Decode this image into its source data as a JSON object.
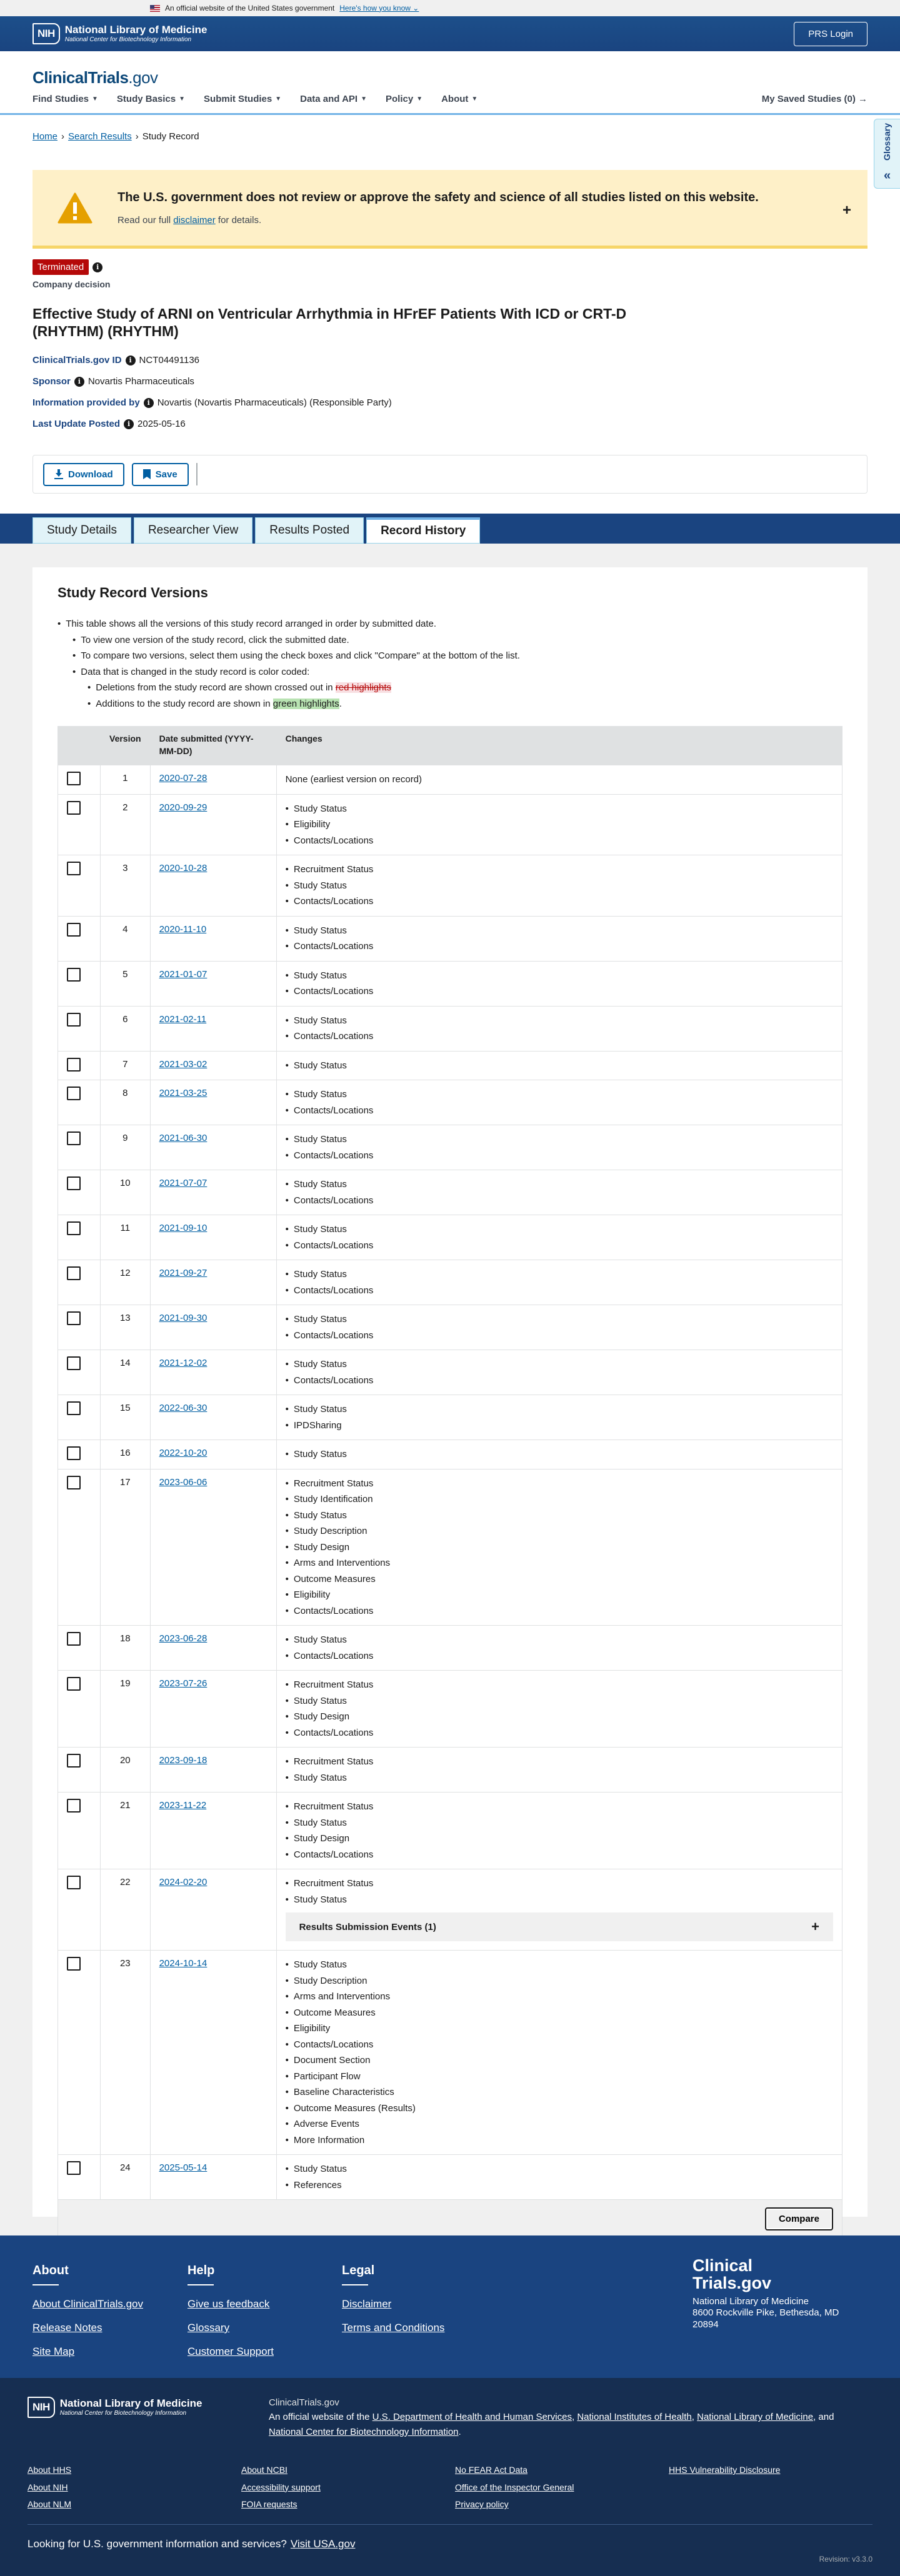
{
  "gov_banner": {
    "text": "An official website of the United States government",
    "link": "Here's how you know"
  },
  "nlm": {
    "nih": "NIH",
    "title": "National Library of Medicine",
    "subtitle": "National Center for Biotechnology Information",
    "prs_login": "PRS Login"
  },
  "site": {
    "brand_main": "ClinicalTrials",
    "brand_suffix": ".gov"
  },
  "nav": {
    "items": [
      "Find Studies",
      "Study Basics",
      "Submit Studies",
      "Data and API",
      "Policy",
      "About"
    ],
    "saved": "My Saved Studies (0)"
  },
  "glossary": {
    "label": "Glossary"
  },
  "breadcrumb": {
    "home": "Home",
    "search": "Search Results",
    "current": "Study Record"
  },
  "alert": {
    "heading": "The U.S. government does not review or approve the safety and science of all studies listed on this website.",
    "pre": "Read our full",
    "link": "disclaimer",
    "post": "for details."
  },
  "study": {
    "status": "Terminated",
    "decision": "Company decision",
    "title": "Effective Study of ARNI on Ventricular Arrhythmia in HFrEF Patients With ICD or CRT-D (RHYTHM) (RHYTHM)",
    "id_label": "ClinicalTrials.gov ID",
    "id_value": "NCT04491136",
    "sponsor_label": "Sponsor",
    "sponsor_value": "Novartis Pharmaceuticals",
    "info_label": "Information provided by",
    "info_value": "Novartis (Novartis Pharmaceuticals) (Responsible Party)",
    "update_label": "Last Update Posted",
    "update_value": "2025-05-16"
  },
  "actions": {
    "download": "Download",
    "save": "Save"
  },
  "tabs": [
    "Study Details",
    "Researcher View",
    "Results Posted",
    "Record History"
  ],
  "records": {
    "title": "Study Record Versions",
    "instr1": "This table shows all the versions of this study record arranged in order by submitted date.",
    "instr2": "To view one version of the study record, click the submitted date.",
    "instr3": "To compare two versions, select them using the check boxes and click \"Compare\" at the bottom of the list.",
    "instr4": "Data that is changed in the study record is color coded:",
    "instr5_pre": "Deletions from the study record are shown crossed out in",
    "instr5_hl": "red highlights",
    "instr6_pre": "Additions to the study record are shown in",
    "instr6_hl": "green highlights",
    "col_version": "Version",
    "col_date": "Date submitted (YYYY-MM-DD)",
    "col_changes": "Changes",
    "compare": "Compare",
    "rows": [
      {
        "v": "1",
        "d": "2020-07-28",
        "c": [
          "None (earliest version on record)"
        ]
      },
      {
        "v": "2",
        "d": "2020-09-29",
        "c": [
          "Study Status",
          "Eligibility",
          "Contacts/Locations"
        ]
      },
      {
        "v": "3",
        "d": "2020-10-28",
        "c": [
          "Recruitment Status",
          "Study Status",
          "Contacts/Locations"
        ]
      },
      {
        "v": "4",
        "d": "2020-11-10",
        "c": [
          "Study Status",
          "Contacts/Locations"
        ]
      },
      {
        "v": "5",
        "d": "2021-01-07",
        "c": [
          "Study Status",
          "Contacts/Locations"
        ]
      },
      {
        "v": "6",
        "d": "2021-02-11",
        "c": [
          "Study Status",
          "Contacts/Locations"
        ]
      },
      {
        "v": "7",
        "d": "2021-03-02",
        "c": [
          "Study Status"
        ]
      },
      {
        "v": "8",
        "d": "2021-03-25",
        "c": [
          "Study Status",
          "Contacts/Locations"
        ]
      },
      {
        "v": "9",
        "d": "2021-06-30",
        "c": [
          "Study Status",
          "Contacts/Locations"
        ]
      },
      {
        "v": "10",
        "d": "2021-07-07",
        "c": [
          "Study Status",
          "Contacts/Locations"
        ]
      },
      {
        "v": "11",
        "d": "2021-09-10",
        "c": [
          "Study Status",
          "Contacts/Locations"
        ]
      },
      {
        "v": "12",
        "d": "2021-09-27",
        "c": [
          "Study Status",
          "Contacts/Locations"
        ]
      },
      {
        "v": "13",
        "d": "2021-09-30",
        "c": [
          "Study Status",
          "Contacts/Locations"
        ]
      },
      {
        "v": "14",
        "d": "2021-12-02",
        "c": [
          "Study Status",
          "Contacts/Locations"
        ]
      },
      {
        "v": "15",
        "d": "2022-06-30",
        "c": [
          "Study Status",
          "IPDSharing"
        ]
      },
      {
        "v": "16",
        "d": "2022-10-20",
        "c": [
          "Study Status"
        ]
      },
      {
        "v": "17",
        "d": "2023-06-06",
        "c": [
          "Recruitment Status",
          "Study Identification",
          "Study Status",
          "Study Description",
          "Study Design",
          "Arms and Interventions",
          "Outcome Measures",
          "Eligibility",
          "Contacts/Locations"
        ]
      },
      {
        "v": "18",
        "d": "2023-06-28",
        "c": [
          "Study Status",
          "Contacts/Locations"
        ]
      },
      {
        "v": "19",
        "d": "2023-07-26",
        "c": [
          "Recruitment Status",
          "Study Status",
          "Study Design",
          "Contacts/Locations"
        ]
      },
      {
        "v": "20",
        "d": "2023-09-18",
        "c": [
          "Recruitment Status",
          "Study Status"
        ]
      },
      {
        "v": "21",
        "d": "2023-11-22",
        "c": [
          "Recruitment Status",
          "Study Status",
          "Study Design",
          "Contacts/Locations"
        ]
      },
      {
        "v": "22",
        "d": "2024-02-20",
        "c": [
          "Recruitment Status",
          "Study Status"
        ],
        "events": "Results Submission Events (1)"
      },
      {
        "v": "23",
        "d": "2024-10-14",
        "c": [
          "Study Status",
          "Study Description",
          "Arms and Interventions",
          "Outcome Measures",
          "Eligibility",
          "Contacts/Locations",
          "Document Section",
          "Participant Flow",
          "Baseline Characteristics",
          "Outcome Measures (Results)",
          "Adverse Events",
          "More Information"
        ]
      },
      {
        "v": "24",
        "d": "2025-05-14",
        "c": [
          "Study Status",
          "References"
        ]
      }
    ]
  },
  "footer": {
    "about_h": "About",
    "about_links": [
      "About ClinicalTrials.gov",
      "Release Notes",
      "Site Map"
    ],
    "help_h": "Help",
    "help_links": [
      "Give us feedback",
      "Glossary",
      "Customer Support"
    ],
    "legal_h": "Legal",
    "legal_links": [
      "Disclaimer",
      "Terms and Conditions"
    ],
    "brand1": "Clinical",
    "brand2": "Trials.gov",
    "addr1": "National Library of Medicine",
    "addr2": "8600 Rockville Pike, Bethesda, MD",
    "addr3": "20894",
    "site": "ClinicalTrials.gov",
    "official_pre": "An official website of the",
    "org1": "U.S. Department of Health and Human Services",
    "org2": "National Institutes of Health",
    "org3": "National Library of Medicine",
    "and": "and",
    "org4": "National Center for Biotechnology Information",
    "links": [
      "About HHS",
      "About NCBI",
      "No FEAR Act Data",
      "HHS Vulnerability Disclosure",
      "About NIH",
      "Accessibility support",
      "Office of the Inspector General",
      "About NLM",
      "FOIA requests",
      "Privacy policy"
    ],
    "usagov_text": "Looking for U.S. government information and services?",
    "usagov_link": "Visit USA.gov",
    "revision": "Revision: v3.3.0"
  }
}
